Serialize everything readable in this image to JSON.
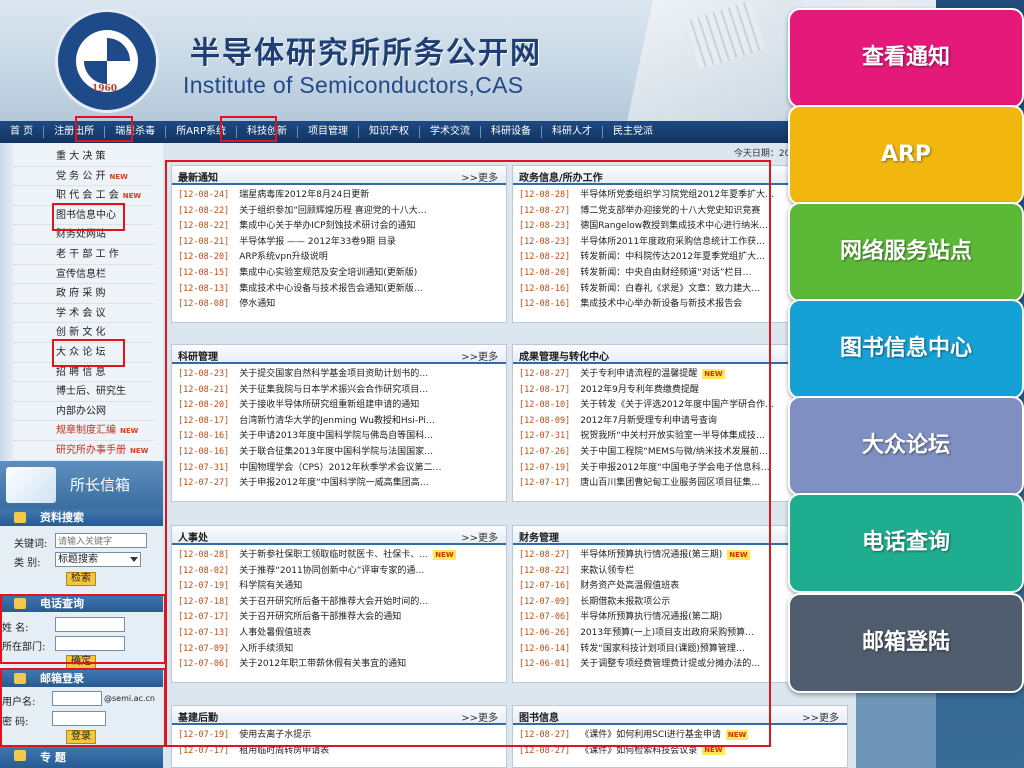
{
  "header": {
    "title": "半导体研究所所务公开网",
    "subtitle": "Institute of Semiconductors,CAS",
    "logo_year": "1960"
  },
  "nav": [
    "首 页",
    "注册出所",
    "瑞星杀毒",
    "所ARP系统",
    "科技创新",
    "项目管理",
    "知识产权",
    "学术交流",
    "科研设备",
    "科研人才",
    "民主党派"
  ],
  "sidebar": {
    "items": [
      {
        "label": "重 大 决 策",
        "new": false,
        "red": false
      },
      {
        "label": "党 务 公 开",
        "new": true,
        "red": false
      },
      {
        "label": "职 代 会 工 会",
        "new": true,
        "red": false
      },
      {
        "label": "图书信息中心",
        "new": false,
        "red": false
      },
      {
        "label": "财务处网站",
        "new": false,
        "red": false
      },
      {
        "label": "老 干 部 工 作",
        "new": false,
        "red": false
      },
      {
        "label": "宣传信息栏",
        "new": false,
        "red": false
      },
      {
        "label": "政 府 采 购",
        "new": false,
        "red": false
      },
      {
        "label": "学 术 会 议",
        "new": false,
        "red": false
      },
      {
        "label": "创 新 文 化",
        "new": false,
        "red": false
      },
      {
        "label": "大 众 论 坛",
        "new": false,
        "red": false
      },
      {
        "label": "招 聘 信 息",
        "new": false,
        "red": false
      },
      {
        "label": "博士后、研究生",
        "new": false,
        "red": false
      },
      {
        "label": "内部办公网",
        "new": false,
        "red": false
      },
      {
        "label": "规章制度汇编",
        "new": true,
        "red": true
      },
      {
        "label": "研究所办事手册",
        "new": true,
        "red": true
      }
    ],
    "new_badge": "NEW",
    "director_mailbox": "所长信箱",
    "search": {
      "title": "资料搜索",
      "keyword_label": "关键词:",
      "keyword_placeholder": "请输入关键字",
      "category_label": "类  别:",
      "category_value": "标题搜索",
      "button": "检索"
    },
    "phone": {
      "title": "电话查询",
      "name_label": "姓    名:",
      "dept_label": "所在部门:",
      "button": "确定"
    },
    "mail": {
      "title": "邮箱登录",
      "user_label": "用户名:",
      "domain": "@semi.ac.cn",
      "pwd_label": "密  码:",
      "button": "登录"
    },
    "special": "专    题"
  },
  "date_text": "今天日期：2012年8月29日",
  "more_label": ">>更多",
  "sections": [
    {
      "title": "最新通知",
      "rows": [
        {
          "date": "[12-08-24]",
          "text": "瑞星病毒库2012年8月24日更新",
          "new": false
        },
        {
          "date": "[12-08-22]",
          "text": "关于组织参加“回顾辉煌历程 喜迎党的十八大…",
          "new": false
        },
        {
          "date": "[12-08-22]",
          "text": "集成中心关于举办ICP刻蚀技术研讨会的通知",
          "new": false
        },
        {
          "date": "[12-08-21]",
          "text": "半导体学报 —— 2012年33卷9期 目录",
          "new": false
        },
        {
          "date": "[12-08-20]",
          "text": "ARP系统vpn升级说明",
          "new": false
        },
        {
          "date": "[12-08-15]",
          "text": "集成中心实验室规范及安全培训通知(更新版)",
          "new": false
        },
        {
          "date": "[12-08-13]",
          "text": "集成技术中心设备与技术报告会通知(更新版…",
          "new": false
        },
        {
          "date": "[12-08-08]",
          "text": "停水通知",
          "new": false
        }
      ]
    },
    {
      "title": "政务信息/所办工作",
      "rows": [
        {
          "date": "[12-08-28]",
          "text": "半导体所党委组织学习院党组2012年夏季扩大…",
          "new": false
        },
        {
          "date": "[12-08-27]",
          "text": "博二党支部举办迎接党的十八大党史知识竞赛",
          "new": false
        },
        {
          "date": "[12-08-23]",
          "text": "德国Rangelow教授到集成技术中心进行纳米…",
          "new": false
        },
        {
          "date": "[12-08-23]",
          "text": "半导体所2011年度政府采购信息统计工作获…",
          "new": false
        },
        {
          "date": "[12-08-22]",
          "text": "转发新闻：中科院传达2012年夏季党组扩大…",
          "new": false
        },
        {
          "date": "[12-08-20]",
          "text": "转发新闻：中央自由财经频道“对话”栏目…",
          "new": false
        },
        {
          "date": "[12-08-16]",
          "text": "转发新闻：白春礼《求是》文章：致力建大…",
          "new": false
        },
        {
          "date": "[12-08-16]",
          "text": "集成技术中心举办新设备与新技术报告会",
          "new": false
        }
      ]
    },
    {
      "title": "科研管理",
      "rows": [
        {
          "date": "[12-08-23]",
          "text": "关于提交国家自然科学基金项目资助计划书的…",
          "new": false
        },
        {
          "date": "[12-08-21]",
          "text": "关于征集我院与日本学术振兴会合作研究项目…",
          "new": false
        },
        {
          "date": "[12-08-20]",
          "text": "关于接收半导体所研究组重新组建申请的通知",
          "new": false
        },
        {
          "date": "[12-08-17]",
          "text": "台湾新竹清华大学的Jenming Wu教授和Hsi-Pi…",
          "new": false
        },
        {
          "date": "[12-08-16]",
          "text": "关于申请2013年度中国科学院与佛岛自等国科…",
          "new": false
        },
        {
          "date": "[12-08-16]",
          "text": "关于联合征集2013年度中国科学院与法国国家…",
          "new": false
        },
        {
          "date": "[12-07-31]",
          "text": "中国物理学会（CPS）2012年秋季学术会议第二…",
          "new": false
        },
        {
          "date": "[12-07-27]",
          "text": "关于申报2012年度“中国科学院一威高集团高…",
          "new": false
        }
      ]
    },
    {
      "title": "成果管理与转化中心",
      "rows": [
        {
          "date": "[12-08-27]",
          "text": "关于专利申请流程的温馨提醒",
          "new": true
        },
        {
          "date": "[12-08-17]",
          "text": "2012年9月专利年费缴费提醒",
          "new": false
        },
        {
          "date": "[12-08-10]",
          "text": "关于转发《关于评选2012年度中国产学研合作…",
          "new": false
        },
        {
          "date": "[12-08-09]",
          "text": "2012年7月新受理专利申请号查询",
          "new": false
        },
        {
          "date": "[12-07-31]",
          "text": "祝贺我所“中关村开放实验室一半导体集成技…",
          "new": false
        },
        {
          "date": "[12-07-26]",
          "text": "关于中国工程院“MEMS与微/纳米技术发展前…",
          "new": false
        },
        {
          "date": "[12-07-19]",
          "text": "关于申报2012年度“中国电子学会电子信息科…",
          "new": false
        },
        {
          "date": "[12-07-17]",
          "text": "唐山百川集团曹妃甸工业服务园区项目征集…",
          "new": false
        }
      ]
    },
    {
      "title": "人事处",
      "rows": [
        {
          "date": "[12-08-28]",
          "text": "关于新参社保职工领取临时就医卡、社保卡、…",
          "new": true
        },
        {
          "date": "[12-08-02]",
          "text": "关于推荐“2011协同创新中心”评审专家的通…",
          "new": false
        },
        {
          "date": "[12-07-19]",
          "text": "科学院有关通知",
          "new": false
        },
        {
          "date": "[12-07-18]",
          "text": "关于召开研究所后备干部推荐大会开始时间的…",
          "new": false
        },
        {
          "date": "[12-07-17]",
          "text": "关于召开研究所后备干部推荐大会的通知",
          "new": false
        },
        {
          "date": "[12-07-13]",
          "text": "人事处暑假值班表",
          "new": false
        },
        {
          "date": "[12-07-09]",
          "text": "入所手续须知",
          "new": false
        },
        {
          "date": "[12-07-06]",
          "text": "关于2012年职工带薪休假有关事宜的通知",
          "new": false
        }
      ]
    },
    {
      "title": "财务管理",
      "rows": [
        {
          "date": "[12-08-27]",
          "text": "半导体所预算执行情况通报(第三期)",
          "new": true
        },
        {
          "date": "[12-08-22]",
          "text": "来款认领专栏",
          "new": false
        },
        {
          "date": "[12-07-16]",
          "text": "财务资产处高温假值班表",
          "new": false
        },
        {
          "date": "[12-07-09]",
          "text": "长期借款未报款项公示",
          "new": false
        },
        {
          "date": "[12-07-06]",
          "text": "半导体所预算执行情况通报(第二期)",
          "new": false
        },
        {
          "date": "[12-06-26]",
          "text": "2013年预算(一上)项目支出政府采购预算…",
          "new": false
        },
        {
          "date": "[12-06-14]",
          "text": "转发“国家科技计划项目(课题)预算管理…",
          "new": false
        },
        {
          "date": "[12-06-01]",
          "text": "关于调整专项经费管理费计提或分摊办法的…",
          "new": false
        }
      ]
    },
    {
      "title": "基建后勤",
      "rows": [
        {
          "date": "[12-07-19]",
          "text": "使用去离子水提示",
          "new": false
        },
        {
          "date": "[12-07-17]",
          "text": "租用临时周转房申请表",
          "new": false
        }
      ]
    },
    {
      "title": "图书信息",
      "rows": [
        {
          "date": "[12-08-27]",
          "text": "《课件》如何利用SCI进行基金申请",
          "new": true
        },
        {
          "date": "[12-08-27]",
          "text": "《课件》如何检索科技会议录",
          "new": true
        }
      ]
    }
  ],
  "callouts": [
    {
      "label": "查看通知",
      "color": "#e4197a"
    },
    {
      "label": "ARP",
      "color": "#f1b70f"
    },
    {
      "label": "网络服务站点",
      "color": "#5cb837"
    },
    {
      "label": "图书信息中心",
      "color": "#16a1d6"
    },
    {
      "label": "大众论坛",
      "color": "#7f8fc2"
    },
    {
      "label": "电话查询",
      "color": "#1eae8f"
    },
    {
      "label": "邮箱登陆",
      "color": "#4f5d6e"
    }
  ],
  "colors": {
    "highlight": "#e0141e",
    "nav_bg": "#1d4a83",
    "date": "#c24a10"
  }
}
